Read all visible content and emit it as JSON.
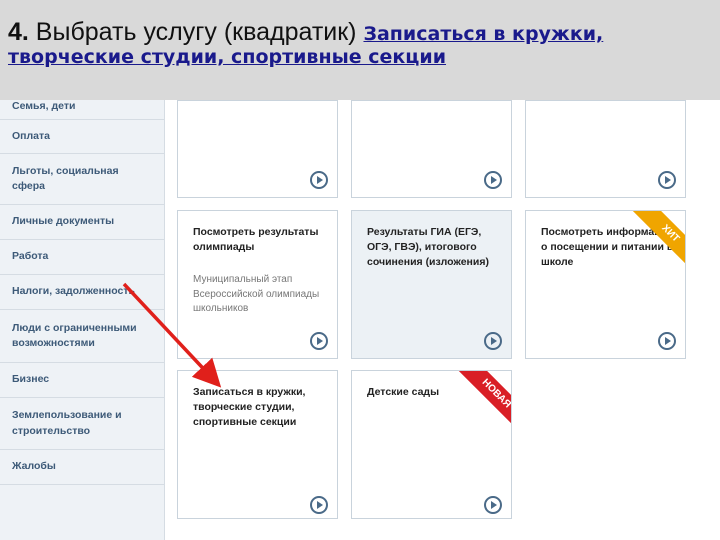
{
  "header": {
    "step": "4.",
    "title_main": " Выбрать услугу (квадратик) ",
    "title_link": "Записаться в кружки, творческие студии, спортивные секции"
  },
  "sidebar": {
    "items": [
      {
        "label": "Семья, дети"
      },
      {
        "label": "Оплата"
      },
      {
        "label": "Льготы, социальная сфера"
      },
      {
        "label": "Личные документы"
      },
      {
        "label": "Работа"
      },
      {
        "label": "Налоги, задолженность"
      },
      {
        "label": "Люди с ограниченными возможностями"
      },
      {
        "label": "Бизнес"
      },
      {
        "label": "Землепользование и строительство"
      },
      {
        "label": "Жалобы"
      }
    ]
  },
  "tiles": [
    {
      "title": "",
      "subtitle": "",
      "badge": ""
    },
    {
      "title": "",
      "subtitle": "",
      "badge": ""
    },
    {
      "title": "",
      "subtitle": "",
      "badge": ""
    },
    {
      "title": "Посмотреть результаты олимпиады",
      "subtitle": "Муниципальный этап Всероссийской олимпиады школьников",
      "badge": ""
    },
    {
      "title": "Результаты ГИА (ЕГЭ, ОГЭ, ГВЭ), итогового сочинения (изложения)",
      "subtitle": "",
      "badge": ""
    },
    {
      "title": "Посмотреть информацию о посещении и питании в школе",
      "subtitle": "",
      "badge": "ХИТ"
    },
    {
      "title": "Записаться в кружки, творческие студии, спортивные секции",
      "subtitle": "",
      "badge": ""
    },
    {
      "title": "Детские сады",
      "subtitle": "",
      "badge": "НОВАЯ"
    }
  ],
  "colors": {
    "arrow": "#e0201b",
    "hit_ribbon": "#f0a500",
    "new_ribbon": "#d91f26",
    "sidebar_text": "#3d5a78"
  }
}
